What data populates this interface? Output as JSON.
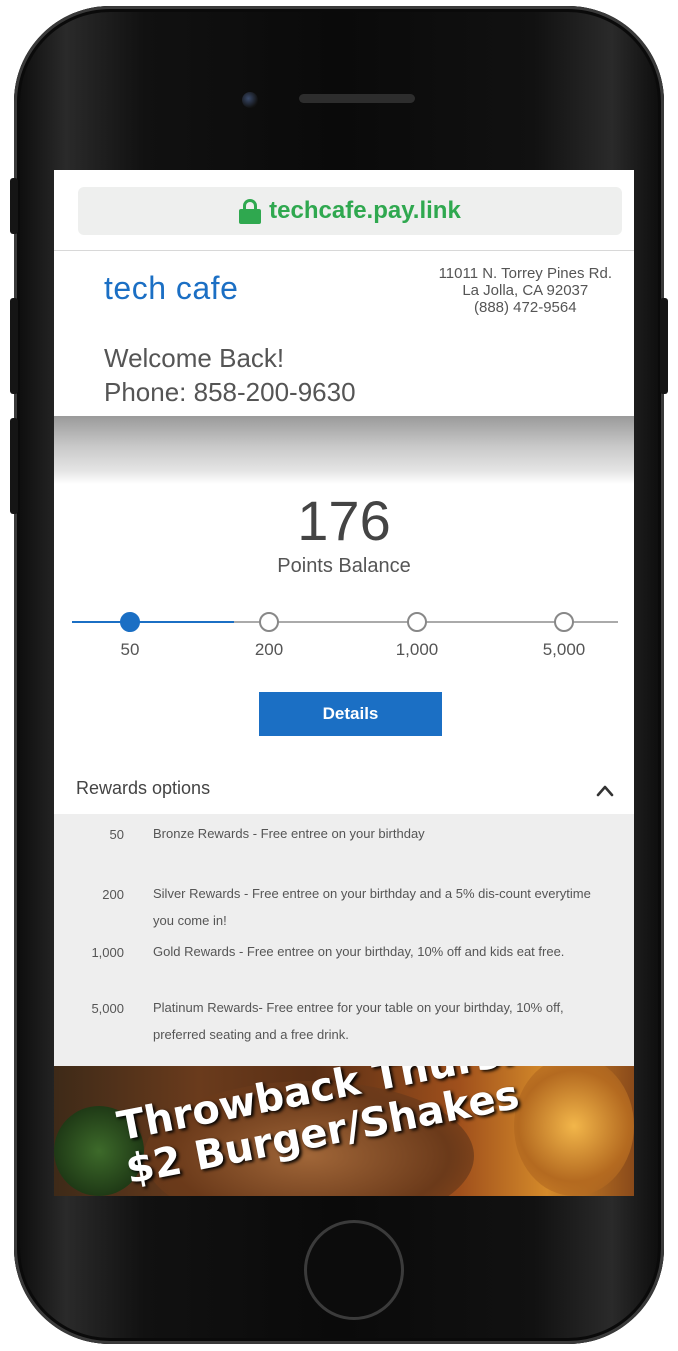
{
  "browser": {
    "url": "techcafe.pay.link",
    "accent_color": "#2fa84f"
  },
  "header": {
    "brand": "tech cafe",
    "address_line1": "11011 N. Torrey Pines Rd.",
    "address_line2": "La Jolla, CA 92037",
    "address_phone": "(888) 472-9564",
    "welcome": "Welcome Back!",
    "phone": "Phone: 858-200-9630",
    "brand_color": "#1b6fc4"
  },
  "points": {
    "balance": "176",
    "label": "Points Balance"
  },
  "tiers": {
    "items": [
      "50",
      "200",
      "1,000",
      "5,000"
    ],
    "active_index": 0,
    "progress_fraction": 0.3
  },
  "actions": {
    "details_label": "Details"
  },
  "rewards": {
    "title": "Rewards options",
    "expanded": true,
    "options": [
      {
        "points": "50",
        "description": "Bronze Rewards - Free entree on your birthday"
      },
      {
        "points": "200",
        "description": "Silver Rewards - Free entree on your birthday and a 5% dis-count everytime you come in!"
      },
      {
        "points": "1,000",
        "description": "Gold Rewards - Free entree on your birthday, 10% off and kids eat free."
      },
      {
        "points": "5,000",
        "description": "Platinum Rewards- Free entree for your table on your birthday, 10% off, preferred seating and a free drink."
      }
    ]
  },
  "promo": {
    "line1": "Throwback Thurs.",
    "line2": "$2 Burger/Shakes"
  }
}
